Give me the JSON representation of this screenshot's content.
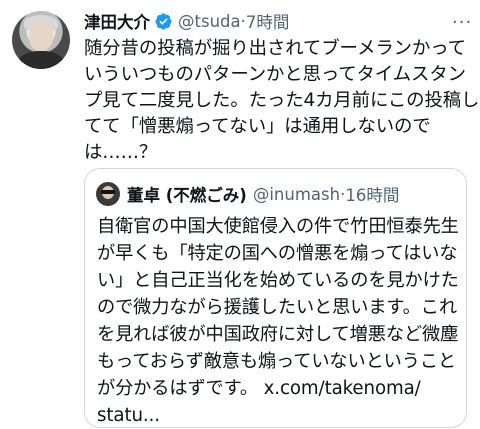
{
  "tweet": {
    "author_name": "津田大介",
    "handle": "@tsuda",
    "separator": "·",
    "time": "7時間",
    "more_label": "···",
    "text_lines": [
      "随分昔の投稿が掘り出されてブーメランかって",
      "いういつものパターンかと思ってタイムスタン",
      "プ見て二度見した。たった4カ月前にこの投稿し",
      "てて「憎悪煽ってない」は通用しないので",
      "は……？"
    ]
  },
  "quote": {
    "author_name": "董卓 (不燃ごみ)",
    "handle": "@inumash",
    "separator": "·",
    "time": "16時間",
    "text_lines": [
      "自衛官の中国大使館侵入の件で竹田恒泰先生",
      "が早くも「特定の国への憎悪を煽ってはいな",
      "い」と自己正当化を始めているのを見かけた",
      "ので微力ながら援護したいと思います。これ",
      "を見れば彼が中国政府に対して増悪など微塵",
      "もっておらず敵意も煽っていないということ",
      "が分かるはずです。 x.com/takenoma/",
      "statu..."
    ]
  },
  "colors": {
    "text": "#0f1419",
    "secondary": "#536471",
    "verified": "#1d9bf0",
    "border": "#cfd9de"
  }
}
